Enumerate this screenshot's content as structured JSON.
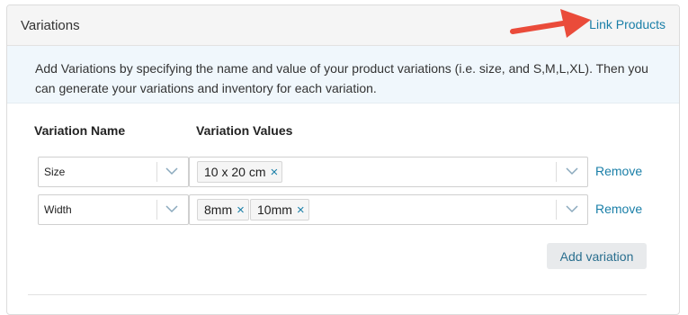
{
  "panel": {
    "title": "Variations",
    "link_products_label": "Link Products",
    "info_text": "Add Variations by specifying the name and value of your product variations (i.e. size, and S,M,L,XL). Then you can generate your variations and inventory for each variation."
  },
  "columns": {
    "name_label": "Variation Name",
    "values_label": "Variation Values"
  },
  "rows": [
    {
      "name": "Size",
      "values": [
        "10 x 20 cm"
      ],
      "remove_label": "Remove"
    },
    {
      "name": "Width",
      "values": [
        "8mm",
        "10mm"
      ],
      "remove_label": "Remove"
    }
  ],
  "tag_remove_glyph": "×",
  "add_variation_label": "Add variation",
  "colors": {
    "link": "#1a7fa8",
    "arrow": "#ea4b3a",
    "info_bg": "#f0f7fc",
    "header_bg": "#f5f5f5"
  },
  "icons": {
    "annotation": "red-arrow-icon",
    "dropdown": "chevron-down-icon"
  }
}
